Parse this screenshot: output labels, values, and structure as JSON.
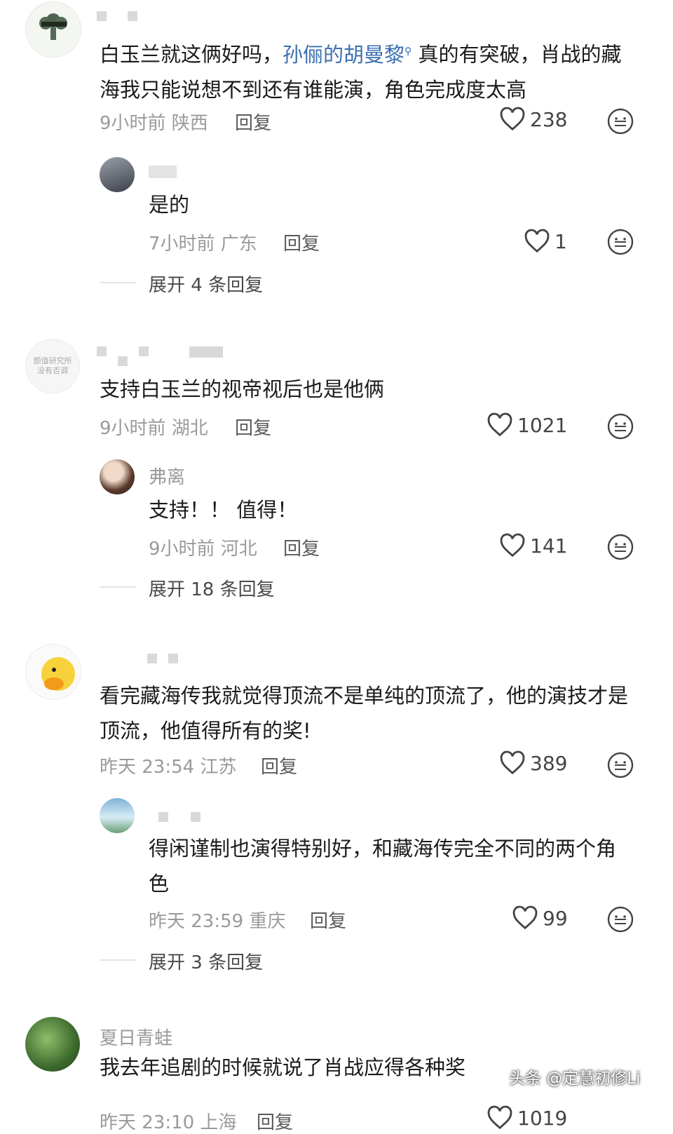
{
  "comments": [
    {
      "text_pre": "白玉兰就这俩好吗，",
      "link": "孙俪的胡曼黎",
      "text_post": "真的有突破，肖战的藏海我只能说想不到还有谁能演，角色完成度太高",
      "meta": "9小时前 陕西",
      "reply_label": "回复",
      "likes": "238",
      "replies": [
        {
          "name": "",
          "text": "是的",
          "meta": "7小时前 广东",
          "reply_label": "回复",
          "likes": "1"
        }
      ],
      "expand": "展开 4 条回复"
    },
    {
      "text": "支持白玉兰的视帝视后也是他俩",
      "meta": "9小时前 湖北",
      "reply_label": "回复",
      "likes": "1021",
      "avatar_text": "颤值研究所 没有否调",
      "replies": [
        {
          "name": "弗离",
          "text": "支持！！ 值得！",
          "meta": "9小时前 河北",
          "reply_label": "回复",
          "likes": "141"
        }
      ],
      "expand": "展开 18 条回复"
    },
    {
      "text": "看完藏海传我就觉得顶流不是单纯的顶流了，他的演技才是顶流，他值得所有的奖!",
      "meta": "昨天 23:54 江苏",
      "reply_label": "回复",
      "likes": "389",
      "replies": [
        {
          "name": "",
          "text": "得闲谨制也演得特别好，和藏海传完全不同的两个角色",
          "meta": "昨天 23:59 重庆",
          "reply_label": "回复",
          "likes": "99"
        }
      ],
      "expand": "展开 3 条回复"
    },
    {
      "name": "夏日青蛙",
      "text": "我去年追剧的时候就说了肖战应得各种奖",
      "meta": "昨天 23:10 上海",
      "reply_label": "回复",
      "likes": "1019"
    }
  ],
  "watermark": "头条 @定慧初修Li",
  "icons": {
    "like": "heart-icon",
    "dislike": "meh-face-icon"
  },
  "colors": {
    "link": "#3a6fb0",
    "meta": "#9a9a9a",
    "text": "#1b1b1b"
  }
}
